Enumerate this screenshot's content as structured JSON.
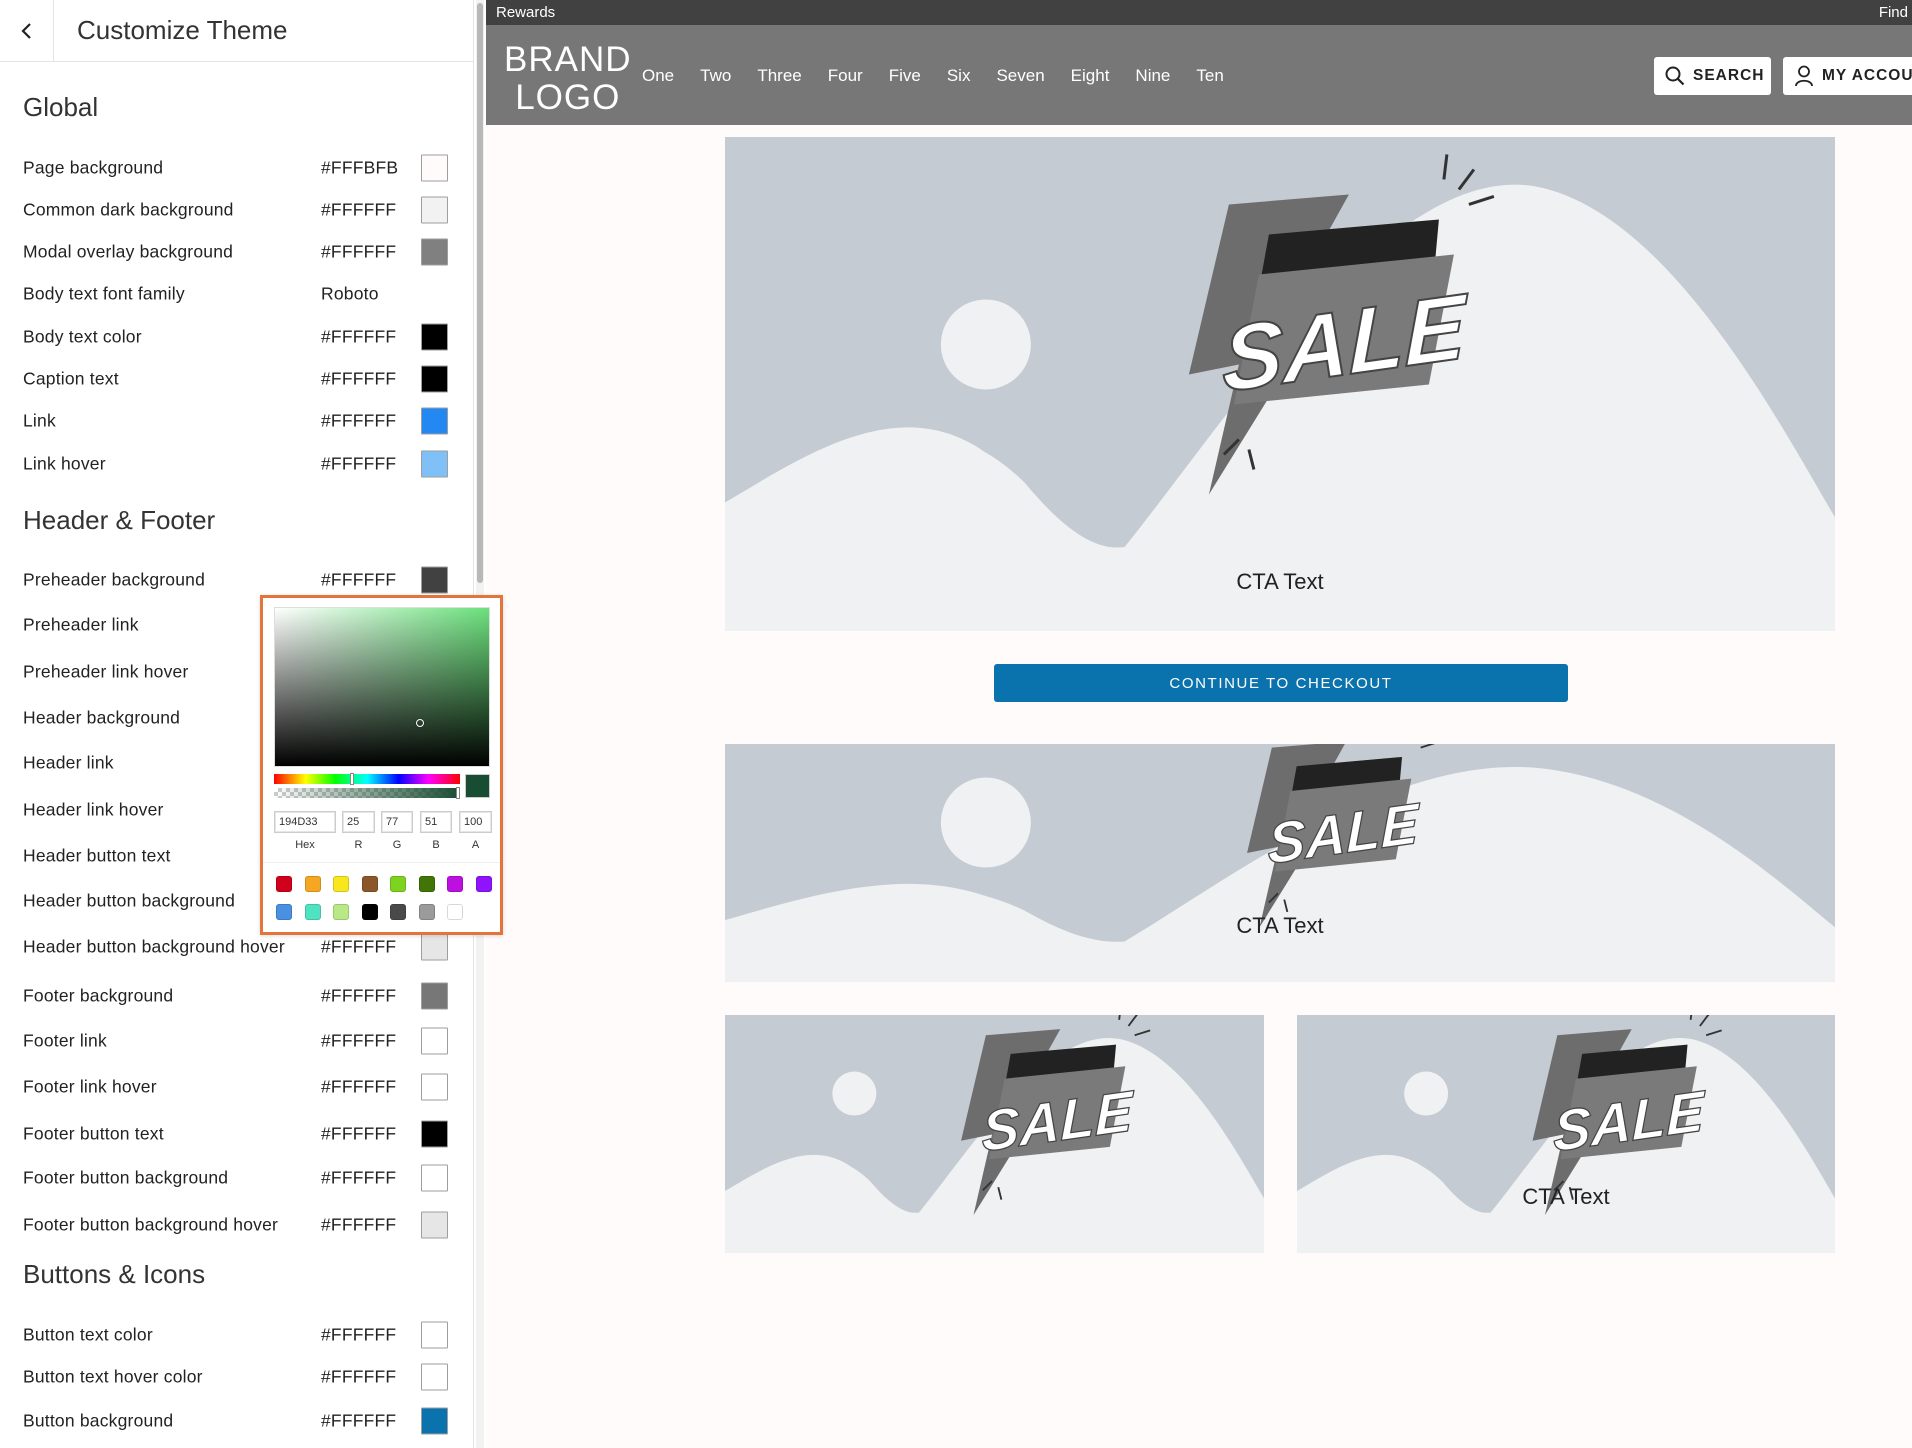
{
  "panel": {
    "title": "Customize Theme",
    "sections": {
      "global": "Global",
      "header_footer": "Header & Footer",
      "buttons_icons": "Buttons & Icons"
    },
    "rows": [
      {
        "label": "Page background",
        "value": "#FFFBFB",
        "swatch": "#FFFBFB"
      },
      {
        "label": "Common dark background",
        "value": "#FFFFFF",
        "swatch": "#F2F2F2"
      },
      {
        "label": "Modal overlay background",
        "value": "#FFFFFF",
        "swatch": "#808080"
      },
      {
        "label": "Body text font family",
        "value": "Roboto",
        "swatch": null
      },
      {
        "label": "Body text color",
        "value": "#FFFFFF",
        "swatch": "#000000"
      },
      {
        "label": "Caption text",
        "value": "#FFFFFF",
        "swatch": "#000000"
      },
      {
        "label": "Link",
        "value": "#FFFFFF",
        "swatch": "#2488F2"
      },
      {
        "label": "Link hover",
        "value": "#FFFFFF",
        "swatch": "#7FC1F7"
      },
      {
        "label": "Preheader background",
        "value": "#FFFFFF",
        "swatch": "#414141"
      },
      {
        "label": "Preheader link",
        "value": "",
        "swatch": null
      },
      {
        "label": "Preheader link hover",
        "value": "",
        "swatch": null
      },
      {
        "label": "Header background",
        "value": "",
        "swatch": null
      },
      {
        "label": "Header link",
        "value": "",
        "swatch": null
      },
      {
        "label": "Header link hover",
        "value": "",
        "swatch": null
      },
      {
        "label": "Header button text",
        "value": "",
        "swatch": null
      },
      {
        "label": "Header button background",
        "value": "",
        "swatch": null
      },
      {
        "label": "Header button background hover",
        "value": "#FFFFFF",
        "swatch": "#E6E6E6"
      },
      {
        "label": "Footer background",
        "value": "#FFFFFF",
        "swatch": "#777777"
      },
      {
        "label": "Footer link",
        "value": "#FFFFFF",
        "swatch": "#FFFFFF"
      },
      {
        "label": "Footer link hover",
        "value": "#FFFFFF",
        "swatch": "#FFFFFF"
      },
      {
        "label": "Footer button text",
        "value": "#FFFFFF",
        "swatch": "#000000"
      },
      {
        "label": "Footer button background",
        "value": "#FFFFFF",
        "swatch": "#FFFFFF"
      },
      {
        "label": "Footer button background hover",
        "value": "#FFFFFF",
        "swatch": "#E6E6E6"
      },
      {
        "label": "Button text color",
        "value": "#FFFFFF",
        "swatch": "#FFFFFF"
      },
      {
        "label": "Button text hover color",
        "value": "#FFFFFF",
        "swatch": "#FFFFFF"
      },
      {
        "label": "Button background",
        "value": "#FFFFFF",
        "swatch": "#0A72AD"
      }
    ]
  },
  "picker": {
    "hex": "194D33",
    "r": "25",
    "g": "77",
    "b": "51",
    "a": "100",
    "labels": {
      "hex": "Hex",
      "r": "R",
      "g": "G",
      "b": "B",
      "a": "A"
    },
    "current_color": "#194D33",
    "presets": [
      "#D0021B",
      "#F5A623",
      "#F8E71C",
      "#8B572A",
      "#7ED321",
      "#417505",
      "#BD10E0",
      "#9013FE",
      "#4A90E2",
      "#50E3C2",
      "#B8E986",
      "#000000",
      "#4A4A4A",
      "#9B9B9B",
      "#FFFFFF"
    ]
  },
  "site": {
    "preheader": {
      "left": "Rewards",
      "right": "Find"
    },
    "logo_line1": "BRAND",
    "logo_line2": "LOGO",
    "nav": [
      "One",
      "Two",
      "Three",
      "Four",
      "Five",
      "Six",
      "Seven",
      "Eight",
      "Nine",
      "Ten"
    ],
    "search_label": "SEARCH",
    "account_label": "MY ACCOUNT",
    "sale_word": "SALE",
    "cta": "CTA Text",
    "checkout_label": "CONTINUE TO CHECKOUT"
  }
}
